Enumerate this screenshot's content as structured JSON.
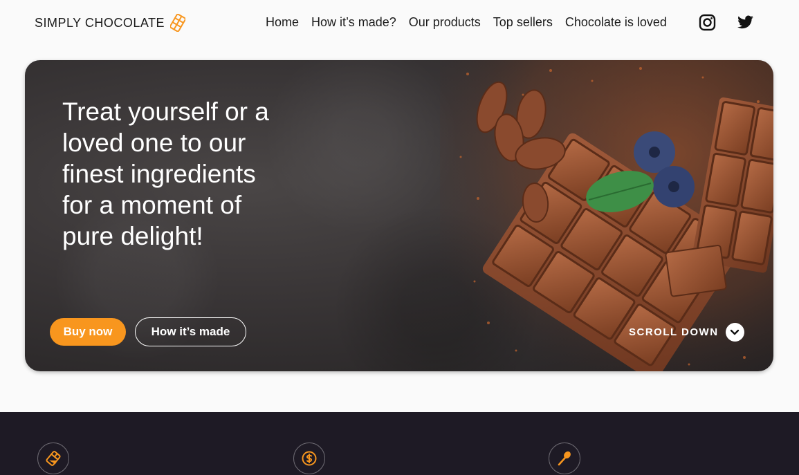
{
  "header": {
    "logo_text": "SIMPLY CHOCOLATE",
    "logo_icon": "chocolate-bar-icon",
    "nav": [
      {
        "label": "Home"
      },
      {
        "label": "How it’s made?"
      },
      {
        "label": "Our products"
      },
      {
        "label": "Top sellers"
      },
      {
        "label": "Chocolate is loved"
      }
    ],
    "social": [
      {
        "icon": "instagram-icon"
      },
      {
        "icon": "twitter-icon"
      }
    ]
  },
  "hero": {
    "title": "Treat yourself or a loved one to our finest ingredients for a moment of pure delight!",
    "buy_button": "Buy now",
    "how_button": "How it’s made",
    "scroll_label": "SCROLL DOWN",
    "scroll_icon": "chevron-down-icon"
  },
  "features": {
    "icons": [
      "chocolate-bar-icon",
      "coin-icon",
      "spoon-icon"
    ]
  },
  "colors": {
    "accent": "#f8961e",
    "dark": "#1e1a25",
    "background": "#fafafa"
  }
}
